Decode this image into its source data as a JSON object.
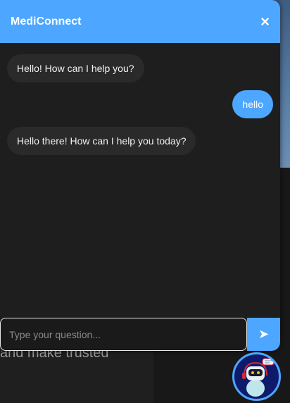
{
  "header": {
    "title": "MediConnect",
    "close_icon": "×"
  },
  "messages": [
    {
      "sender": "bot",
      "text": "Hello! How can I help you?"
    },
    {
      "sender": "user",
      "text": "hello"
    },
    {
      "sender": "bot",
      "text": "Hello there! How can I help you today?"
    }
  ],
  "input": {
    "placeholder": "Type your question...",
    "value": ""
  },
  "send_icon": "➤",
  "background": {
    "text": "and make trusted"
  },
  "colors": {
    "accent": "#4da6ff",
    "panel": "#1e1e1e",
    "bot_bubble": "#2a2a2a"
  }
}
